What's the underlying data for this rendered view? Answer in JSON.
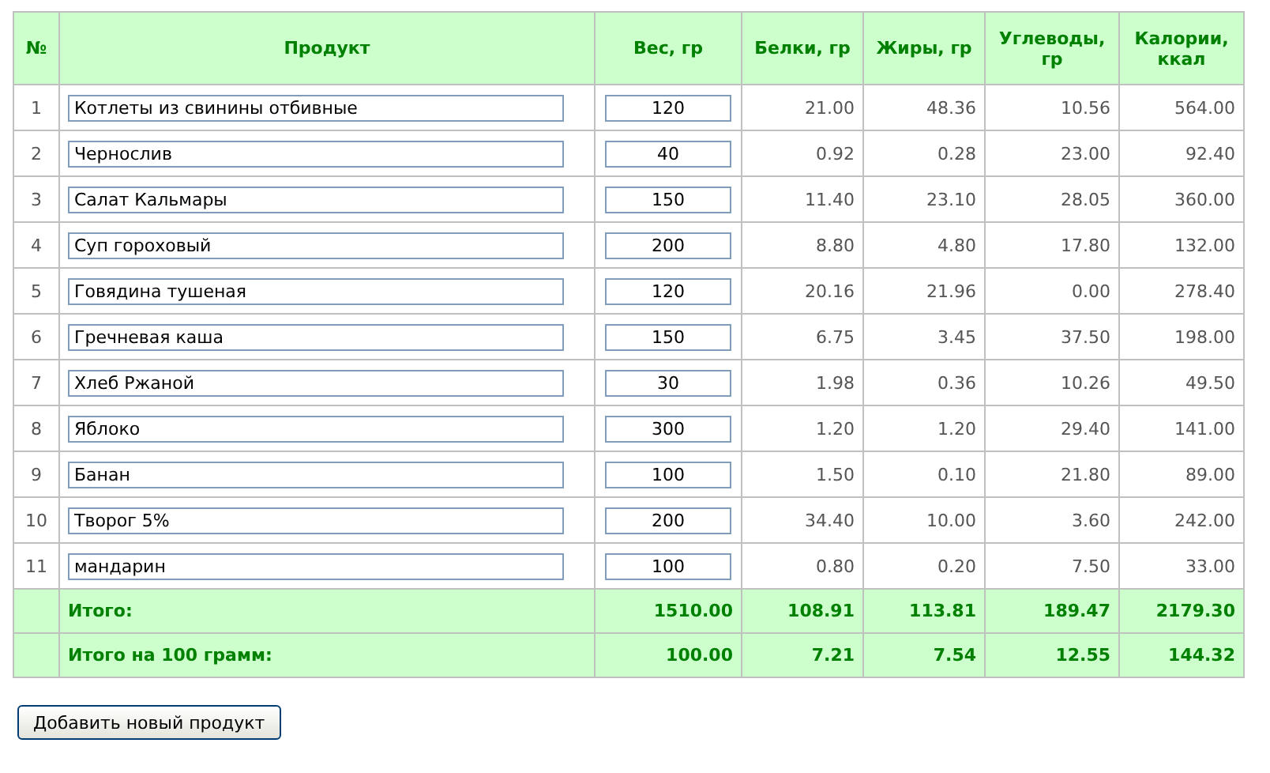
{
  "table": {
    "columns": [
      "№",
      "Продукт",
      "Вес, гр",
      "Белки, гр",
      "Жиры, гр",
      "Углеводы, гр",
      "Калории, ккал"
    ],
    "rows": [
      {
        "number": "1",
        "product": "Котлеты из свинины отбивные",
        "weight": "120",
        "protein": "21.00",
        "fat": "48.36",
        "carbs": "10.56",
        "calories": "564.00"
      },
      {
        "number": "2",
        "product": "Чернослив",
        "weight": "40",
        "protein": "0.92",
        "fat": "0.28",
        "carbs": "23.00",
        "calories": "92.40"
      },
      {
        "number": "3",
        "product": "Салат Кальмары",
        "weight": "150",
        "protein": "11.40",
        "fat": "23.10",
        "carbs": "28.05",
        "calories": "360.00"
      },
      {
        "number": "4",
        "product": "Суп гороховый",
        "weight": "200",
        "protein": "8.80",
        "fat": "4.80",
        "carbs": "17.80",
        "calories": "132.00"
      },
      {
        "number": "5",
        "product": "Говядина тушеная",
        "weight": "120",
        "protein": "20.16",
        "fat": "21.96",
        "carbs": "0.00",
        "calories": "278.40"
      },
      {
        "number": "6",
        "product": "Гречневая каша",
        "weight": "150",
        "protein": "6.75",
        "fat": "3.45",
        "carbs": "37.50",
        "calories": "198.00"
      },
      {
        "number": "7",
        "product": "Хлеб Ржаной",
        "weight": "30",
        "protein": "1.98",
        "fat": "0.36",
        "carbs": "10.26",
        "calories": "49.50"
      },
      {
        "number": "8",
        "product": "Яблоко",
        "weight": "300",
        "protein": "1.20",
        "fat": "1.20",
        "carbs": "29.40",
        "calories": "141.00"
      },
      {
        "number": "9",
        "product": "Банан",
        "weight": "100",
        "protein": "1.50",
        "fat": "0.10",
        "carbs": "21.80",
        "calories": "89.00"
      },
      {
        "number": "10",
        "product": "Творог 5%",
        "weight": "200",
        "protein": "34.40",
        "fat": "10.00",
        "carbs": "3.60",
        "calories": "242.00"
      },
      {
        "number": "11",
        "product": "мандарин",
        "weight": "100",
        "protein": "0.80",
        "fat": "0.20",
        "carbs": "7.50",
        "calories": "33.00"
      }
    ],
    "totals": [
      {
        "label": "Итого:",
        "values": [
          "1510.00",
          "108.91",
          "113.81",
          "189.47",
          "2179.30"
        ]
      },
      {
        "label": "Итого на 100 грамм:",
        "values": [
          "100.00",
          "7.21",
          "7.54",
          "12.55",
          "144.32"
        ]
      }
    ]
  },
  "add_button": "Добавить новый продукт"
}
